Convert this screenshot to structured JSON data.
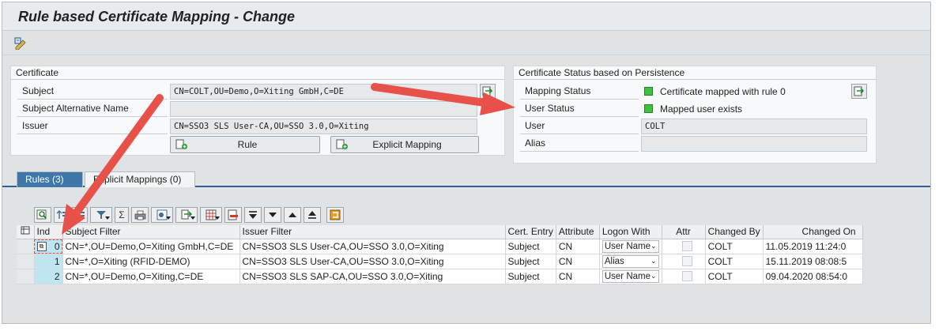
{
  "window": {
    "title": "Rule based Certificate Mapping - Change"
  },
  "toolbar": {
    "icon": "display-change-icon"
  },
  "certificate": {
    "title": "Certificate",
    "subject_label": "Subject",
    "subject_value": "CN=COLT,OU=Demo,O=Xiting GmbH,C=DE",
    "san_label": "Subject Alternative Name",
    "san_value": "",
    "issuer_label": "Issuer",
    "issuer_value": "CN=SSO3 SLS User-CA,OU=SSO 3.0,O=Xiting",
    "rule_button": "Rule",
    "explicit_button": "Explicit Mapping"
  },
  "status": {
    "title": "Certificate Status based on Persistence",
    "mapping_label": "Mapping Status",
    "mapping_value": "Certificate mapped with rule 0",
    "user_status_label": "User Status",
    "user_status_value": "Mapped user exists",
    "user_label": "User",
    "user_value": "COLT",
    "alias_label": "Alias",
    "alias_value": "",
    "status_color": "#3cc43c"
  },
  "tabs": [
    {
      "label": "Rules (3)",
      "active": true
    },
    {
      "label": "Explicit Mappings (0)",
      "active": false
    }
  ],
  "grid": {
    "columns": [
      "Ind",
      "Subject Filter",
      "Issuer Filter",
      "Cert. Entry",
      "Attribute",
      "Logon With",
      "Attr",
      "Changed By",
      "Changed On"
    ],
    "rows": [
      {
        "ind": "0",
        "subject": "CN=*,OU=Demo,O=Xiting GmbH,C=DE",
        "issuer": "CN=SSO3 SLS User-CA,OU=SSO 3.0,O=Xiting",
        "entry": "Subject",
        "attribute": "CN",
        "logon": "User Name",
        "by": "COLT",
        "on": "11.05.2019 11:24:0"
      },
      {
        "ind": "1",
        "subject": "CN=*,O=Xiting (RFID-DEMO)",
        "issuer": "CN=SSO3 SLS User-CA,OU=SSO 3.0,O=Xiting",
        "entry": "Subject",
        "attribute": "CN",
        "logon": "Alias",
        "by": "COLT",
        "on": "15.11.2019 08:08:5"
      },
      {
        "ind": "2",
        "subject": "CN=*,OU=Demo,O=Xiting,C=DE",
        "issuer": "CN=SSO3 SLS SAP-CA,OU=SSO 3.0,O=Xiting",
        "entry": "Subject",
        "attribute": "CN",
        "logon": "User Name",
        "by": "COLT",
        "on": "09.04.2020 08:54:0"
      }
    ]
  },
  "annotation": {
    "arrow_color": "#e8504a"
  }
}
